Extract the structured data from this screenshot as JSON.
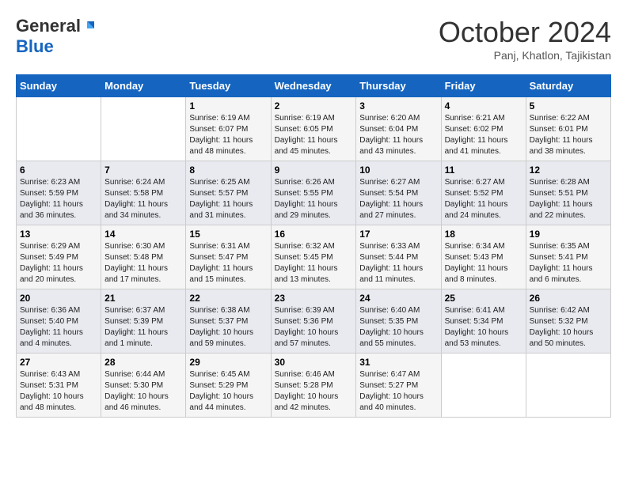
{
  "logo": {
    "general": "General",
    "blue": "Blue"
  },
  "title": "October 2024",
  "subtitle": "Panj, Khatlon, Tajikistan",
  "days_of_week": [
    "Sunday",
    "Monday",
    "Tuesday",
    "Wednesday",
    "Thursday",
    "Friday",
    "Saturday"
  ],
  "weeks": [
    [
      {
        "day": "",
        "info": ""
      },
      {
        "day": "",
        "info": ""
      },
      {
        "day": "1",
        "info": "Sunrise: 6:19 AM\nSunset: 6:07 PM\nDaylight: 11 hours and 48 minutes."
      },
      {
        "day": "2",
        "info": "Sunrise: 6:19 AM\nSunset: 6:05 PM\nDaylight: 11 hours and 45 minutes."
      },
      {
        "day": "3",
        "info": "Sunrise: 6:20 AM\nSunset: 6:04 PM\nDaylight: 11 hours and 43 minutes."
      },
      {
        "day": "4",
        "info": "Sunrise: 6:21 AM\nSunset: 6:02 PM\nDaylight: 11 hours and 41 minutes."
      },
      {
        "day": "5",
        "info": "Sunrise: 6:22 AM\nSunset: 6:01 PM\nDaylight: 11 hours and 38 minutes."
      }
    ],
    [
      {
        "day": "6",
        "info": "Sunrise: 6:23 AM\nSunset: 5:59 PM\nDaylight: 11 hours and 36 minutes."
      },
      {
        "day": "7",
        "info": "Sunrise: 6:24 AM\nSunset: 5:58 PM\nDaylight: 11 hours and 34 minutes."
      },
      {
        "day": "8",
        "info": "Sunrise: 6:25 AM\nSunset: 5:57 PM\nDaylight: 11 hours and 31 minutes."
      },
      {
        "day": "9",
        "info": "Sunrise: 6:26 AM\nSunset: 5:55 PM\nDaylight: 11 hours and 29 minutes."
      },
      {
        "day": "10",
        "info": "Sunrise: 6:27 AM\nSunset: 5:54 PM\nDaylight: 11 hours and 27 minutes."
      },
      {
        "day": "11",
        "info": "Sunrise: 6:27 AM\nSunset: 5:52 PM\nDaylight: 11 hours and 24 minutes."
      },
      {
        "day": "12",
        "info": "Sunrise: 6:28 AM\nSunset: 5:51 PM\nDaylight: 11 hours and 22 minutes."
      }
    ],
    [
      {
        "day": "13",
        "info": "Sunrise: 6:29 AM\nSunset: 5:49 PM\nDaylight: 11 hours and 20 minutes."
      },
      {
        "day": "14",
        "info": "Sunrise: 6:30 AM\nSunset: 5:48 PM\nDaylight: 11 hours and 17 minutes."
      },
      {
        "day": "15",
        "info": "Sunrise: 6:31 AM\nSunset: 5:47 PM\nDaylight: 11 hours and 15 minutes."
      },
      {
        "day": "16",
        "info": "Sunrise: 6:32 AM\nSunset: 5:45 PM\nDaylight: 11 hours and 13 minutes."
      },
      {
        "day": "17",
        "info": "Sunrise: 6:33 AM\nSunset: 5:44 PM\nDaylight: 11 hours and 11 minutes."
      },
      {
        "day": "18",
        "info": "Sunrise: 6:34 AM\nSunset: 5:43 PM\nDaylight: 11 hours and 8 minutes."
      },
      {
        "day": "19",
        "info": "Sunrise: 6:35 AM\nSunset: 5:41 PM\nDaylight: 11 hours and 6 minutes."
      }
    ],
    [
      {
        "day": "20",
        "info": "Sunrise: 6:36 AM\nSunset: 5:40 PM\nDaylight: 11 hours and 4 minutes."
      },
      {
        "day": "21",
        "info": "Sunrise: 6:37 AM\nSunset: 5:39 PM\nDaylight: 11 hours and 1 minute."
      },
      {
        "day": "22",
        "info": "Sunrise: 6:38 AM\nSunset: 5:37 PM\nDaylight: 10 hours and 59 minutes."
      },
      {
        "day": "23",
        "info": "Sunrise: 6:39 AM\nSunset: 5:36 PM\nDaylight: 10 hours and 57 minutes."
      },
      {
        "day": "24",
        "info": "Sunrise: 6:40 AM\nSunset: 5:35 PM\nDaylight: 10 hours and 55 minutes."
      },
      {
        "day": "25",
        "info": "Sunrise: 6:41 AM\nSunset: 5:34 PM\nDaylight: 10 hours and 53 minutes."
      },
      {
        "day": "26",
        "info": "Sunrise: 6:42 AM\nSunset: 5:32 PM\nDaylight: 10 hours and 50 minutes."
      }
    ],
    [
      {
        "day": "27",
        "info": "Sunrise: 6:43 AM\nSunset: 5:31 PM\nDaylight: 10 hours and 48 minutes."
      },
      {
        "day": "28",
        "info": "Sunrise: 6:44 AM\nSunset: 5:30 PM\nDaylight: 10 hours and 46 minutes."
      },
      {
        "day": "29",
        "info": "Sunrise: 6:45 AM\nSunset: 5:29 PM\nDaylight: 10 hours and 44 minutes."
      },
      {
        "day": "30",
        "info": "Sunrise: 6:46 AM\nSunset: 5:28 PM\nDaylight: 10 hours and 42 minutes."
      },
      {
        "day": "31",
        "info": "Sunrise: 6:47 AM\nSunset: 5:27 PM\nDaylight: 10 hours and 40 minutes."
      },
      {
        "day": "",
        "info": ""
      },
      {
        "day": "",
        "info": ""
      }
    ]
  ]
}
